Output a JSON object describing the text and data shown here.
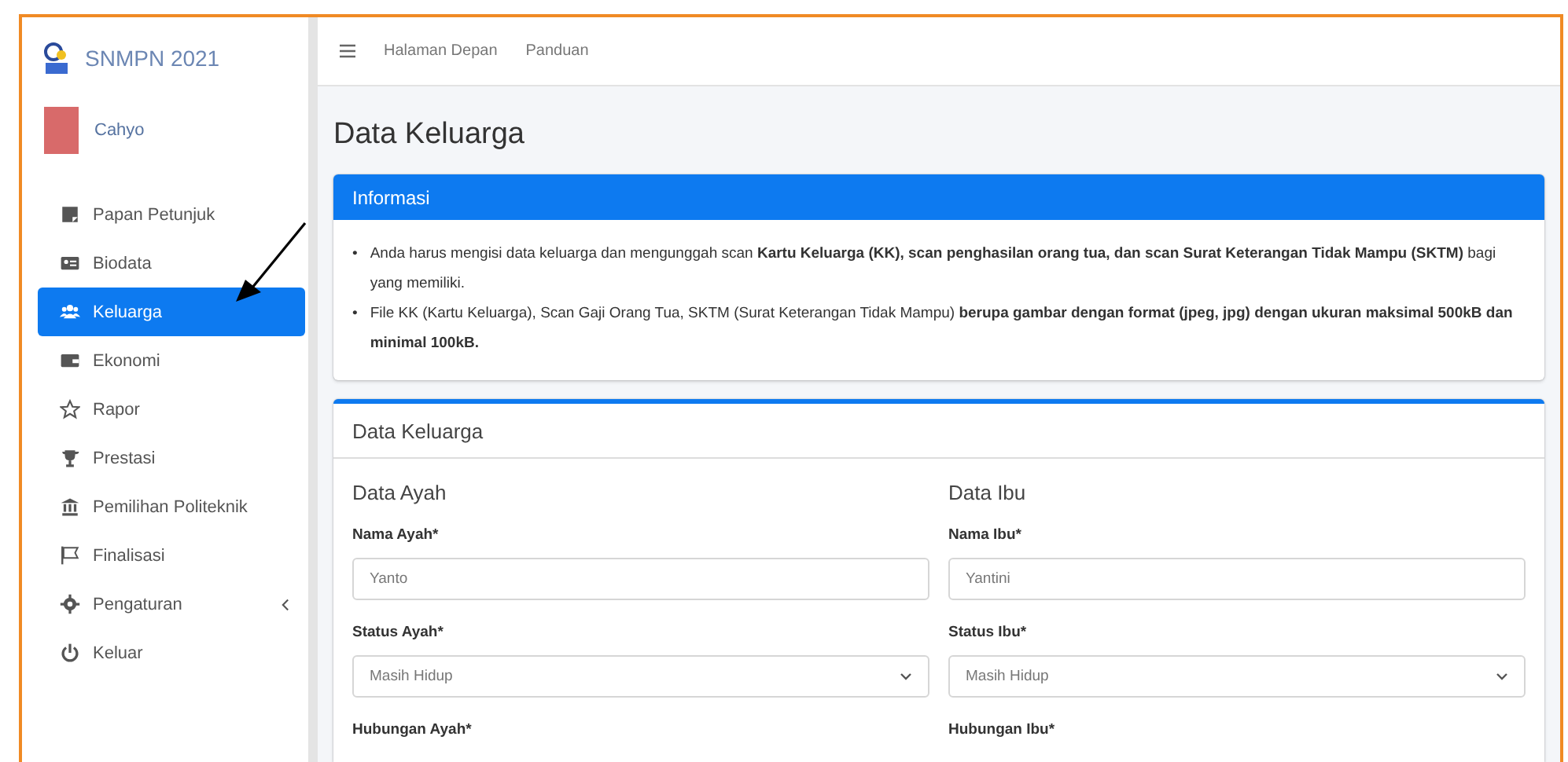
{
  "brand": {
    "title": "SNMPN 2021"
  },
  "user": {
    "name": "Cahyo"
  },
  "sidebar": {
    "items": [
      {
        "label": "Papan Petunjuk",
        "selected": false
      },
      {
        "label": "Biodata",
        "selected": false
      },
      {
        "label": "Keluarga",
        "selected": true
      },
      {
        "label": "Ekonomi",
        "selected": false
      },
      {
        "label": "Rapor",
        "selected": false
      },
      {
        "label": "Prestasi",
        "selected": false
      },
      {
        "label": "Pemilihan Politeknik",
        "selected": false
      },
      {
        "label": "Finalisasi",
        "selected": false
      },
      {
        "label": "Pengaturan",
        "selected": false,
        "expandable": true
      },
      {
        "label": "Keluar",
        "selected": false
      }
    ]
  },
  "navbar": {
    "links": [
      "Halaman Depan",
      "Panduan"
    ]
  },
  "page_title": "Data Keluarga",
  "info_card": {
    "title": "Informasi",
    "items": [
      {
        "bullet": "•",
        "text": "Anda harus mengisi data keluarga dan mengunggah scan **Kartu Keluarga (KK), scan penghasilan orang tua, dan scan Surat Keterangan Tidak Mampu (SKTM)** bagi yang memiliki."
      },
      {
        "bullet": "•",
        "text": "File KK (Kartu Keluarga), Scan Gaji Orang Tua, SKTM (Surat Keterangan Tidak Mampu) **berupa gambar dengan format (jpeg, jpg) dengan ukuran maksimal 500kB dan minimal 100kB.**"
      }
    ]
  },
  "form_card": {
    "title": "Data Keluarga",
    "columns": [
      {
        "heading": "Data Ayah",
        "fields": [
          {
            "kind": "text",
            "label": "Nama Ayah*",
            "value": "Yanto"
          },
          {
            "kind": "select",
            "label": "Status Ayah*",
            "value": "Masih Hidup"
          },
          {
            "kind": "label",
            "label": "Hubungan Ayah*"
          }
        ]
      },
      {
        "heading": "Data Ibu",
        "fields": [
          {
            "kind": "text",
            "label": "Nama Ibu*",
            "value": "Yantini"
          },
          {
            "kind": "select",
            "label": "Status Ibu*",
            "value": "Masih Hidup"
          },
          {
            "kind": "label",
            "label": "Hubungan Ibu*"
          }
        ]
      }
    ]
  }
}
